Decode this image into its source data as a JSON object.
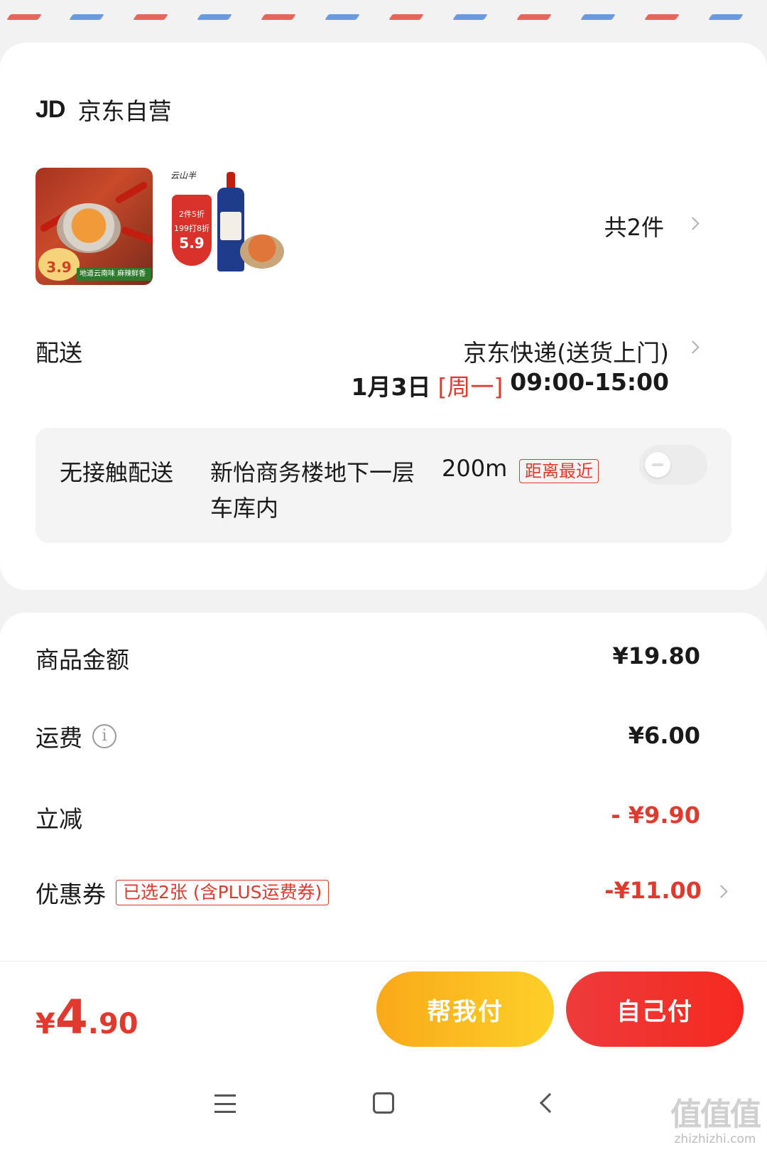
{
  "header": {
    "shop_logo": "JD",
    "shop_name": "京东自营"
  },
  "products": {
    "item1": {
      "price_badge": "3.9",
      "promo_text": "地道云南味 麻辣鲜香"
    },
    "item2": {
      "brand": "云山半",
      "tag_line1": "2件5折",
      "tag_line2": "199打8折",
      "tag_price": "5.9"
    },
    "count_label": "共2件"
  },
  "delivery": {
    "label": "配送",
    "method": "京东快递(送货上门)",
    "date": "1月3日",
    "weekday": "[周一]",
    "time_range": "09:00-15:00"
  },
  "contactless": {
    "title": "无接触配送",
    "address": "新怡商务楼地下一层车库内",
    "distance": "200m",
    "tag": "距离最近",
    "enabled": false
  },
  "summary": {
    "goods_label": "商品金额",
    "goods_value": "¥19.80",
    "shipping_label": "运费",
    "shipping_value": "¥6.00",
    "discount_label": "立减",
    "discount_value": "- ¥9.90",
    "coupon_label": "优惠券",
    "coupon_tag": "已选2张 (含PLUS运费券)",
    "coupon_value": "-¥11.00"
  },
  "footer": {
    "total_currency": "¥",
    "total_integer": "4",
    "total_decimal": ".90",
    "help_pay_label": "帮我付",
    "self_pay_label": "自己付"
  },
  "watermark": {
    "glyphs": "值值值",
    "url": "zhizhizhi.com"
  },
  "colors": {
    "accent_red": "#e03a2e",
    "help_button": "#fbbd22",
    "self_button": "#f03434"
  }
}
